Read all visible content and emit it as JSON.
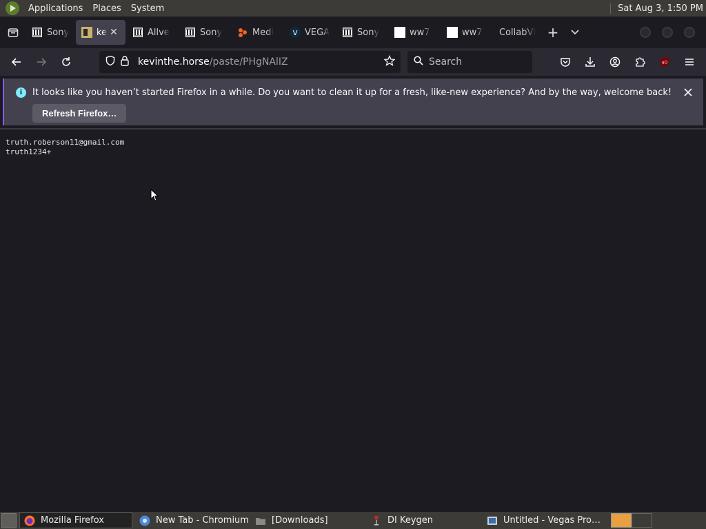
{
  "topbar": {
    "menus": [
      "Applications",
      "Places",
      "System"
    ],
    "clock": "Sat Aug  3,  1:50 PM"
  },
  "tabs": [
    {
      "title": "Sony",
      "icon": "museum-icon",
      "active": false
    },
    {
      "title": "ke",
      "icon": "image-icon",
      "active": true
    },
    {
      "title": "Allve",
      "icon": "museum-icon",
      "active": false
    },
    {
      "title": "Sony",
      "icon": "museum-icon",
      "active": false
    },
    {
      "title": "Medi",
      "icon": "orange-logo-icon",
      "active": false
    },
    {
      "title": "VEGA",
      "icon": "vegas-icon",
      "active": false
    },
    {
      "title": "Sony",
      "icon": "museum-icon",
      "active": false
    },
    {
      "title": "ww7",
      "icon": "blank-page-icon",
      "active": false
    },
    {
      "title": "ww7",
      "icon": "blank-page-icon",
      "active": false
    },
    {
      "title": "CollabVI",
      "icon": "",
      "active": false
    }
  ],
  "url": {
    "host": "kevinthe.horse",
    "path": "/paste/PHgNAlIZ"
  },
  "search": {
    "placeholder": "Search"
  },
  "notification": {
    "message": "It looks like you haven’t started Firefox in a while. Do you want to clean it up for a fresh, like-new experience? And by the way, welcome back!",
    "button": "Refresh Firefox…"
  },
  "page": {
    "lines": [
      "truth.roberson11@gmail.com",
      "truth1234+"
    ]
  },
  "taskbar": {
    "tasks": [
      {
        "label": "Mozilla Firefox",
        "active": true
      },
      {
        "label": "New Tab - Chromium",
        "active": false
      },
      {
        "label": "[Downloads]",
        "active": false
      },
      {
        "label": "DI Keygen",
        "active": false
      },
      {
        "label": "Untitled - Vegas Pro…",
        "active": false
      }
    ]
  },
  "colors": {
    "accent": "#9059ff",
    "info": "#80ebff",
    "panel": "#3c3b37"
  }
}
